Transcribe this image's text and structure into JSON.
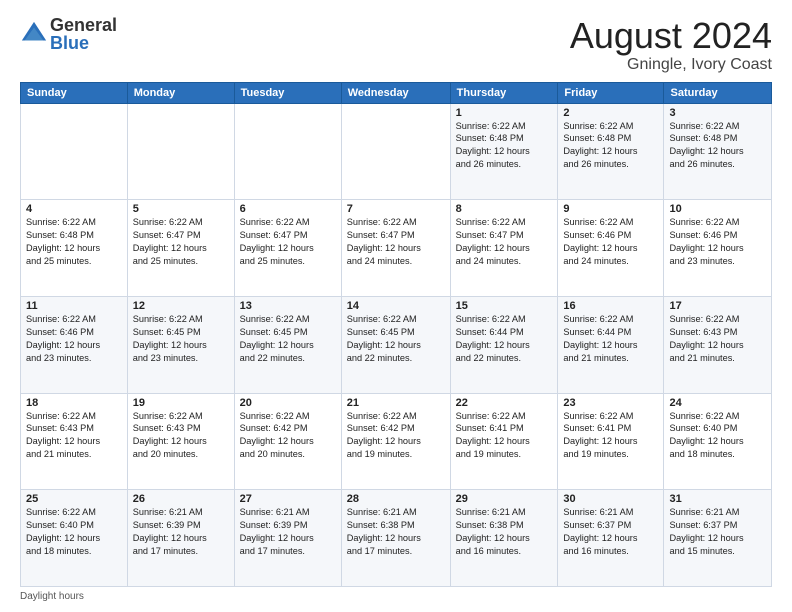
{
  "logo": {
    "general": "General",
    "blue": "Blue"
  },
  "title": "August 2024",
  "location": "Gningle, Ivory Coast",
  "days_of_week": [
    "Sunday",
    "Monday",
    "Tuesday",
    "Wednesday",
    "Thursday",
    "Friday",
    "Saturday"
  ],
  "footer": "Daylight hours",
  "weeks": [
    [
      {
        "day": "",
        "info": ""
      },
      {
        "day": "",
        "info": ""
      },
      {
        "day": "",
        "info": ""
      },
      {
        "day": "",
        "info": ""
      },
      {
        "day": "1",
        "info": "Sunrise: 6:22 AM\nSunset: 6:48 PM\nDaylight: 12 hours\nand 26 minutes."
      },
      {
        "day": "2",
        "info": "Sunrise: 6:22 AM\nSunset: 6:48 PM\nDaylight: 12 hours\nand 26 minutes."
      },
      {
        "day": "3",
        "info": "Sunrise: 6:22 AM\nSunset: 6:48 PM\nDaylight: 12 hours\nand 26 minutes."
      }
    ],
    [
      {
        "day": "4",
        "info": "Sunrise: 6:22 AM\nSunset: 6:48 PM\nDaylight: 12 hours\nand 25 minutes."
      },
      {
        "day": "5",
        "info": "Sunrise: 6:22 AM\nSunset: 6:47 PM\nDaylight: 12 hours\nand 25 minutes."
      },
      {
        "day": "6",
        "info": "Sunrise: 6:22 AM\nSunset: 6:47 PM\nDaylight: 12 hours\nand 25 minutes."
      },
      {
        "day": "7",
        "info": "Sunrise: 6:22 AM\nSunset: 6:47 PM\nDaylight: 12 hours\nand 24 minutes."
      },
      {
        "day": "8",
        "info": "Sunrise: 6:22 AM\nSunset: 6:47 PM\nDaylight: 12 hours\nand 24 minutes."
      },
      {
        "day": "9",
        "info": "Sunrise: 6:22 AM\nSunset: 6:46 PM\nDaylight: 12 hours\nand 24 minutes."
      },
      {
        "day": "10",
        "info": "Sunrise: 6:22 AM\nSunset: 6:46 PM\nDaylight: 12 hours\nand 23 minutes."
      }
    ],
    [
      {
        "day": "11",
        "info": "Sunrise: 6:22 AM\nSunset: 6:46 PM\nDaylight: 12 hours\nand 23 minutes."
      },
      {
        "day": "12",
        "info": "Sunrise: 6:22 AM\nSunset: 6:45 PM\nDaylight: 12 hours\nand 23 minutes."
      },
      {
        "day": "13",
        "info": "Sunrise: 6:22 AM\nSunset: 6:45 PM\nDaylight: 12 hours\nand 22 minutes."
      },
      {
        "day": "14",
        "info": "Sunrise: 6:22 AM\nSunset: 6:45 PM\nDaylight: 12 hours\nand 22 minutes."
      },
      {
        "day": "15",
        "info": "Sunrise: 6:22 AM\nSunset: 6:44 PM\nDaylight: 12 hours\nand 22 minutes."
      },
      {
        "day": "16",
        "info": "Sunrise: 6:22 AM\nSunset: 6:44 PM\nDaylight: 12 hours\nand 21 minutes."
      },
      {
        "day": "17",
        "info": "Sunrise: 6:22 AM\nSunset: 6:43 PM\nDaylight: 12 hours\nand 21 minutes."
      }
    ],
    [
      {
        "day": "18",
        "info": "Sunrise: 6:22 AM\nSunset: 6:43 PM\nDaylight: 12 hours\nand 21 minutes."
      },
      {
        "day": "19",
        "info": "Sunrise: 6:22 AM\nSunset: 6:43 PM\nDaylight: 12 hours\nand 20 minutes."
      },
      {
        "day": "20",
        "info": "Sunrise: 6:22 AM\nSunset: 6:42 PM\nDaylight: 12 hours\nand 20 minutes."
      },
      {
        "day": "21",
        "info": "Sunrise: 6:22 AM\nSunset: 6:42 PM\nDaylight: 12 hours\nand 19 minutes."
      },
      {
        "day": "22",
        "info": "Sunrise: 6:22 AM\nSunset: 6:41 PM\nDaylight: 12 hours\nand 19 minutes."
      },
      {
        "day": "23",
        "info": "Sunrise: 6:22 AM\nSunset: 6:41 PM\nDaylight: 12 hours\nand 19 minutes."
      },
      {
        "day": "24",
        "info": "Sunrise: 6:22 AM\nSunset: 6:40 PM\nDaylight: 12 hours\nand 18 minutes."
      }
    ],
    [
      {
        "day": "25",
        "info": "Sunrise: 6:22 AM\nSunset: 6:40 PM\nDaylight: 12 hours\nand 18 minutes."
      },
      {
        "day": "26",
        "info": "Sunrise: 6:21 AM\nSunset: 6:39 PM\nDaylight: 12 hours\nand 17 minutes."
      },
      {
        "day": "27",
        "info": "Sunrise: 6:21 AM\nSunset: 6:39 PM\nDaylight: 12 hours\nand 17 minutes."
      },
      {
        "day": "28",
        "info": "Sunrise: 6:21 AM\nSunset: 6:38 PM\nDaylight: 12 hours\nand 17 minutes."
      },
      {
        "day": "29",
        "info": "Sunrise: 6:21 AM\nSunset: 6:38 PM\nDaylight: 12 hours\nand 16 minutes."
      },
      {
        "day": "30",
        "info": "Sunrise: 6:21 AM\nSunset: 6:37 PM\nDaylight: 12 hours\nand 16 minutes."
      },
      {
        "day": "31",
        "info": "Sunrise: 6:21 AM\nSunset: 6:37 PM\nDaylight: 12 hours\nand 15 minutes."
      }
    ]
  ]
}
